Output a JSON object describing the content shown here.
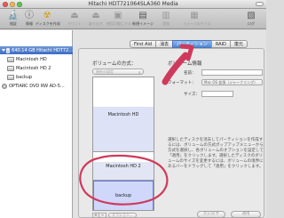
{
  "window": {
    "title": "Hitachi HDT721064SLA360 Media"
  },
  "toolbar": {
    "items": [
      {
        "label": "検証",
        "icon": "microscope-icon"
      },
      {
        "label": "情報",
        "icon": "info-icon"
      },
      {
        "label": "ディスクを作成",
        "icon": "burn-icon"
      },
      {
        "label": "マウント",
        "icon": "mount-icon"
      },
      {
        "label": "取り出す",
        "icon": "eject-icon"
      },
      {
        "label": "使用可能にする",
        "icon": "enable-icon"
      },
      {
        "label": "新規イメージ",
        "icon": "new-image-icon"
      },
      {
        "label": "変換",
        "icon": "convert-icon"
      },
      {
        "label": "イメージのサイズ",
        "icon": "resize-image-icon"
      },
      {
        "label": "ログ",
        "icon": "log-icon"
      }
    ]
  },
  "sidebar": {
    "items": [
      {
        "label": "640.14 GB Hitachi HDT72...",
        "selected": true,
        "kind": "disk"
      },
      {
        "label": "Macintosh HD",
        "kind": "volume"
      },
      {
        "label": "Macintosh HD 2",
        "kind": "volume"
      },
      {
        "label": "backup",
        "kind": "volume"
      },
      {
        "label": "OPTIARC DVD RW AD-5...",
        "kind": "optical"
      }
    ]
  },
  "tabs": [
    {
      "label": "First Aid"
    },
    {
      "label": "消去"
    },
    {
      "label": "パーティション",
      "active": true
    },
    {
      "label": "RAID"
    },
    {
      "label": "復元"
    }
  ],
  "partition": {
    "layout_label": "ボリュームの方式：",
    "layout_popup": "現在の設定",
    "volumes": [
      "Macintosh HD",
      "Macintosh HD 2",
      "backup"
    ],
    "add_button": "+",
    "remove_button": "−",
    "options_button": "オプション..."
  },
  "volume_info": {
    "heading": "ボリューム情報",
    "name_label": "名前：",
    "format_label": "フォーマット：",
    "format_value": "Mac OS 拡張（ジャーナリング）",
    "size_label": "サイズ：",
    "description": "選択したディスクを消去してパーティションを作成するには、ボリュームの方式ポップアップメニューから方式を選択し、各ボリュームのオプションを設定して「適用」をクリックします。選択したディスクのボリュームのサイズを変更するには、ボリュームの境界にあるバーをドラッグして「適用」をクリックします。"
  },
  "buttons": {
    "revert": "元に戻す",
    "apply": "適用"
  },
  "annotation": {
    "color": "#cf3a5c"
  }
}
